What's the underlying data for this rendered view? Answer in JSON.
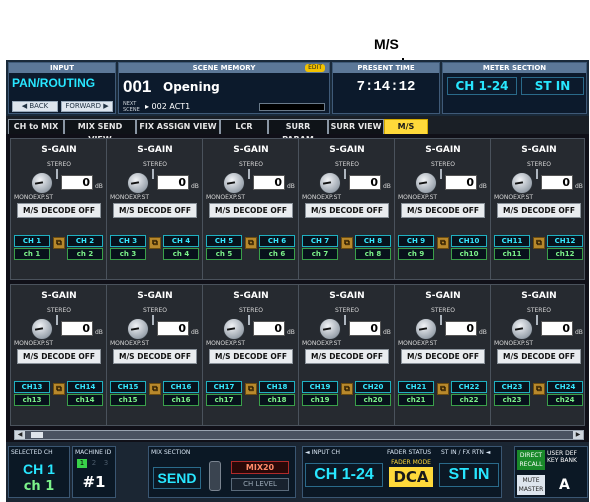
{
  "callout": {
    "label": "M/S"
  },
  "header": {
    "input_tag": "INPUT",
    "screen_title": "PAN/ROUTING",
    "back_label": "◀ BACK",
    "forward_label": "FORWARD ▶",
    "scene_memory_label": "SCENE MEMORY",
    "edit_badge": "EDIT",
    "scene_number": "001",
    "scene_name": "Opening",
    "next_scene_label": "NEXT SCENE",
    "next_scene": "▸ 002 ACT1",
    "present_time_label": "PRESENT TIME",
    "present_time": "7:14:12",
    "meter_section_label": "METER SECTION",
    "meter_ch": "CH 1-24",
    "meter_st": "ST IN"
  },
  "tabs": [
    {
      "label": "CH to MIX"
    },
    {
      "label": "MIX SEND VIEW"
    },
    {
      "label": "FIX ASSIGN VIEW"
    },
    {
      "label": "LCR"
    },
    {
      "label": "SURR PARAM"
    },
    {
      "label": "SURR VIEW"
    },
    {
      "label": "M/S"
    }
  ],
  "unit_labels": {
    "title": "S-GAIN",
    "stereo": "STEREO",
    "mono": "MONO",
    "exp_st": "EXP.ST",
    "value": "0",
    "unit": "dB",
    "decode": "M/S DECODE OFF"
  },
  "rows": [
    [
      {
        "a": "CH 1",
        "b": "CH 2",
        "an": "ch 1",
        "bn": "ch 2"
      },
      {
        "a": "CH 3",
        "b": "CH 4",
        "an": "ch 3",
        "bn": "ch 4"
      },
      {
        "a": "CH 5",
        "b": "CH 6",
        "an": "ch 5",
        "bn": "ch 6"
      },
      {
        "a": "CH 7",
        "b": "CH 8",
        "an": "ch 7",
        "bn": "ch 8"
      },
      {
        "a": "CH 9",
        "b": "CH10",
        "an": "ch 9",
        "bn": "ch10"
      },
      {
        "a": "CH11",
        "b": "CH12",
        "an": "ch11",
        "bn": "ch12"
      }
    ],
    [
      {
        "a": "CH13",
        "b": "CH14",
        "an": "ch13",
        "bn": "ch14"
      },
      {
        "a": "CH15",
        "b": "CH16",
        "an": "ch15",
        "bn": "ch16"
      },
      {
        "a": "CH17",
        "b": "CH18",
        "an": "ch17",
        "bn": "ch18"
      },
      {
        "a": "CH19",
        "b": "CH20",
        "an": "ch19",
        "bn": "ch20"
      },
      {
        "a": "CH21",
        "b": "CH22",
        "an": "ch21",
        "bn": "ch22"
      },
      {
        "a": "CH23",
        "b": "CH24",
        "an": "ch23",
        "bn": "ch24"
      }
    ]
  ],
  "bottom": {
    "selected_ch_label": "SELECTED CH",
    "selected_ch": "CH 1",
    "selected_name": "ch 1",
    "machine_id_label": "MACHINE ID",
    "machine_id": "#1",
    "machine_pages": [
      "1",
      "2",
      "3"
    ],
    "mix_section_label": "MIX SECTION",
    "send_label": "SEND",
    "mix_target": "MIX20",
    "ch_level_label": "CH LEVEL",
    "input_ch_label": "◄ INPUT CH",
    "input_ch": "CH 1-24",
    "fader_status_label": "FADER STATUS",
    "fader_mode_label": "FADER MODE",
    "dca_label": "DCA",
    "st_in_label": "ST IN / FX RTN ◄",
    "st_in": "ST IN",
    "direct_recall": "DIRECT RECALL",
    "mute_master": "MUTE MASTER",
    "user_def": "USER DEF KEY BANK",
    "user_bank": "A"
  },
  "colors": {
    "accent_cyan": "#28e6ff",
    "tab_active": "#ffd93a",
    "channel_green": "#7cf28a"
  }
}
